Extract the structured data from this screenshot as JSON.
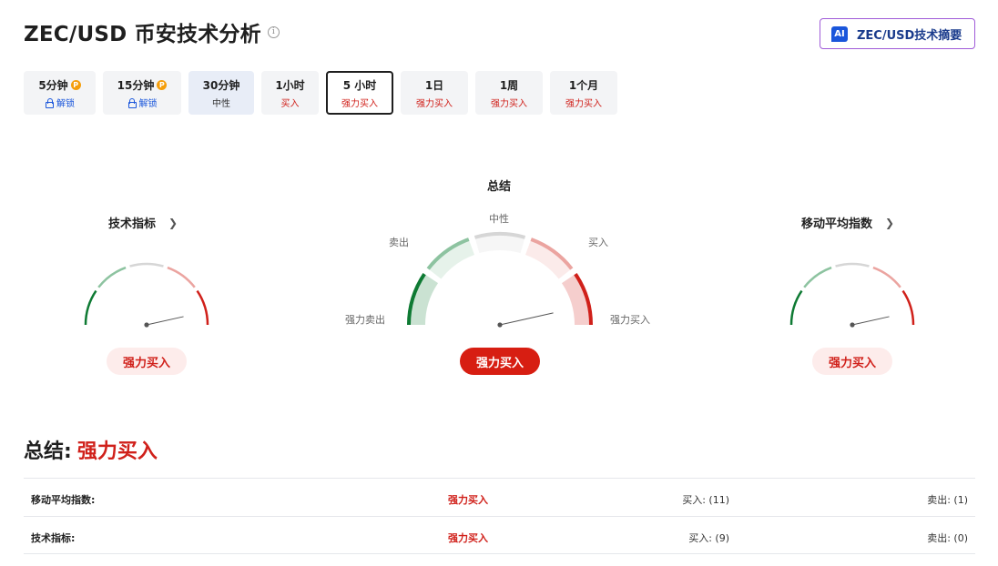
{
  "header": {
    "title": "ZEC/USD 币安技术分析",
    "info_icon": "info-icon",
    "ai_button": {
      "icon": "AI",
      "label": "ZEC/USD技术摘要"
    }
  },
  "timeframes": [
    {
      "name": "5分钟",
      "sub": "解锁",
      "state": "locked"
    },
    {
      "name": "15分钟",
      "sub": "解锁",
      "state": "locked"
    },
    {
      "name": "30分钟",
      "sub": "中性",
      "state": "neutral"
    },
    {
      "name": "1小时",
      "sub": "买入",
      "state": "buy"
    },
    {
      "name": "5 小时",
      "sub": "强力买入",
      "state": "buy",
      "active": true
    },
    {
      "name": "1日",
      "sub": "强力买入",
      "state": "buy"
    },
    {
      "name": "1周",
      "sub": "强力买入",
      "state": "buy"
    },
    {
      "name": "1个月",
      "sub": "强力买入",
      "state": "buy"
    }
  ],
  "gauges": {
    "technical": {
      "title": "技术指标",
      "result": "强力买入",
      "needle_level": 0.93
    },
    "summary": {
      "title": "总结",
      "result": "强力买入",
      "needle_level": 0.93,
      "labels": {
        "strong_sell": "强力卖出",
        "sell": "卖出",
        "neutral": "中性",
        "buy": "买入",
        "strong_buy": "强力买入"
      }
    },
    "moving_averages": {
      "title": "移动平均指数",
      "result": "强力买入",
      "needle_level": 0.93
    }
  },
  "summary": {
    "label": "总结:",
    "value": "强力买入"
  },
  "table": [
    {
      "name": "移动平均指数:",
      "result": "强力买入",
      "buy": "买入: (11)",
      "sell": "卖出: (1)"
    },
    {
      "name": "技术指标:",
      "result": "强力买入",
      "buy": "买入: (9)",
      "sell": "卖出: (0)"
    }
  ],
  "colors": {
    "strong_sell": "#0e7a33",
    "sell": "#8dc3a0",
    "neutral": "#d6d6d6",
    "buy": "#eba4a0",
    "strong_buy": "#d0201a",
    "accent": "#1a56db"
  }
}
